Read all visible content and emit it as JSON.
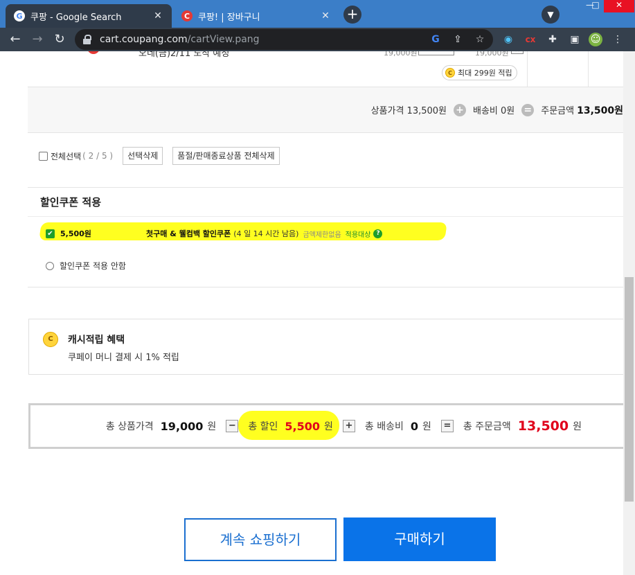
{
  "browser": {
    "tabs": [
      {
        "title": "쿠팡 - Google Search",
        "favicon": "google-favicon-icon",
        "active": true
      },
      {
        "title": "쿠팡! | 장바구니",
        "favicon": "coupang-favicon-icon",
        "active": false
      }
    ],
    "favicon_letters": {
      "google": "G",
      "coupang": "C"
    },
    "new_tab": "+",
    "url_host": "cart.coupang.com",
    "url_path": "/cartView.pang"
  },
  "prev_item": {
    "truncated_text": "오네(금)2/11 도착 예정",
    "truncated_price_1": "19,000원",
    "truncated_price_2": "19,000원",
    "reward_pill": "최대 299원 적립"
  },
  "summary": {
    "product_price": "상품가격 13,500원",
    "shipping": "배송비 0원",
    "order_total_label": "주문금액",
    "order_total_value": "13,500원",
    "plus": "+",
    "equals": "="
  },
  "selection": {
    "select_all_label": "전체선택",
    "select_all_count": "( 2 / 5 )",
    "delete_selected": "선택삭제",
    "delete_soldout": "품절/판매종료상품 전체삭제"
  },
  "coupon": {
    "heading": "할인쿠폰 적용",
    "option1_amount": "5,500원",
    "option1_name": "첫구매 & 웰컴백 할인쿠폰",
    "option1_remaining": "(4 일 14 시간 남음)",
    "option1_limit": "금액제한없음",
    "option1_target": "적용대상",
    "help": "?",
    "option2_label": "할인쿠폰 적용 안함"
  },
  "cash": {
    "coin_letter": "C",
    "title": "캐시적립 혜택",
    "desc": "쿠페이 머니 결제 시 1% 적립"
  },
  "totals": {
    "product_label": "총 상품가격",
    "product_value": "19,000",
    "discount_label": "총 할인",
    "discount_value": "5,500",
    "shipping_label": "총 배송비",
    "shipping_value": "0",
    "order_label": "총 주문금액",
    "order_value": "13,500",
    "unit": "원",
    "minus": "−",
    "plus": "+",
    "equals": "="
  },
  "actions": {
    "continue_shopping": "계속 쇼핑하기",
    "buy": "구매하기"
  },
  "colors": {
    "buy_button": "#0a73e8",
    "highlight": "#ffff20",
    "price_red": "#e0001b",
    "check_green": "#1f9d2b"
  }
}
